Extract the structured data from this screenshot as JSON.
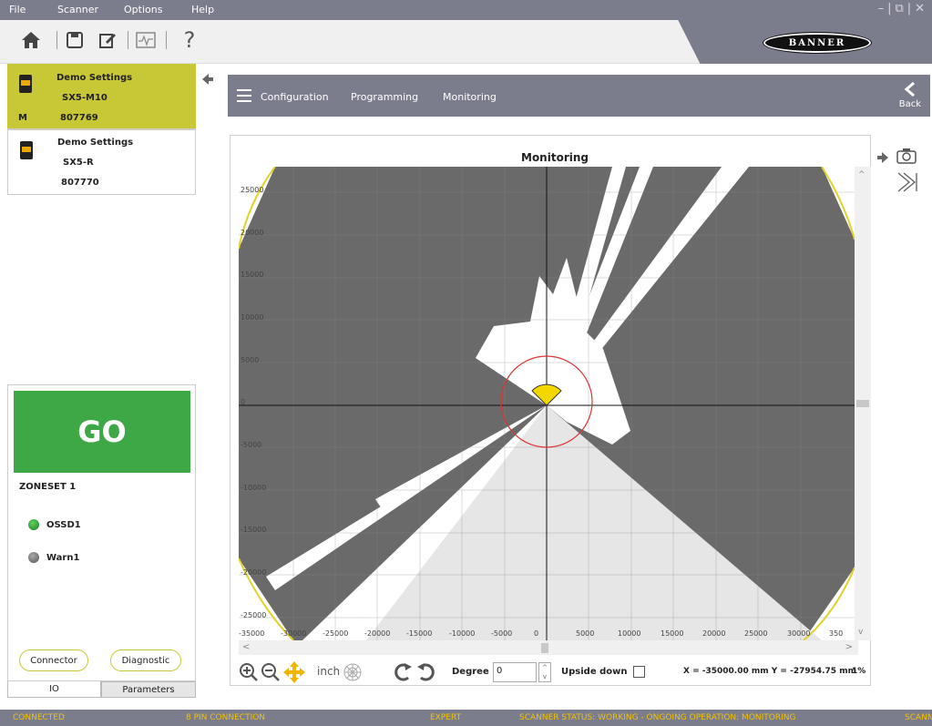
{
  "menu": {
    "file": "File",
    "scanner": "Scanner",
    "options": "Options",
    "help": "Help"
  },
  "window_controls": "–|⧉|✕",
  "brand": {
    "logo_text": "BANNER"
  },
  "devices": [
    {
      "name": "Demo Settings",
      "model": "SX5-M10",
      "serial": "807769",
      "badge": "M",
      "selected": true
    },
    {
      "name": "Demo Settings",
      "model": "SX5-R",
      "serial": "807770",
      "badge": "",
      "selected": false
    }
  ],
  "status": {
    "go_label": "GO",
    "zoneset": "ZONESET 1",
    "outputs": [
      {
        "label": "OSSD1",
        "color": "#1f7a1f"
      },
      {
        "label": "Warn1",
        "color": "#6e6e6e"
      }
    ],
    "connector_button": "Connector",
    "diagnostic_button": "Diagnostic"
  },
  "left_tabs": {
    "io": "IO",
    "parameters": "Parameters"
  },
  "nav": {
    "configuration": "Configuration",
    "programming": "Programming",
    "monitoring": "Monitoring",
    "back": "Back"
  },
  "plot": {
    "title": "Monitoring",
    "x_ticks": [
      "-35000",
      "-30000",
      "-25000",
      "-20000",
      "-15000",
      "-10000",
      "-5000",
      "0",
      "5000",
      "10000",
      "15000",
      "20000",
      "25000",
      "30000",
      "350"
    ],
    "y_ticks": [
      "25000",
      "20000",
      "15000",
      "10000",
      "5000",
      "0",
      "-5000",
      "-10000",
      "-15000",
      "-20000",
      "-25000"
    ],
    "unit_label": "inch",
    "degree_label": "Degree",
    "degree_value": "0",
    "upside_down_label": "Upside down",
    "coordinates": "X = -35000.00 mm  Y = -27954.75 mm",
    "zoom": "1%"
  },
  "statusbar": {
    "connection": "CONNECTED",
    "pins": "8 PIN CONNECTION",
    "mode": "EXPERT",
    "scanner_status": "SCANNER STATUS: WORKING - ONGOING OPERATION: MONITORING",
    "overflow": "SCANN"
  },
  "colors": {
    "accent": "#c8c837",
    "go": "#3fa846",
    "chrome": "#7b7d8c",
    "status_text": "#f2c200"
  }
}
